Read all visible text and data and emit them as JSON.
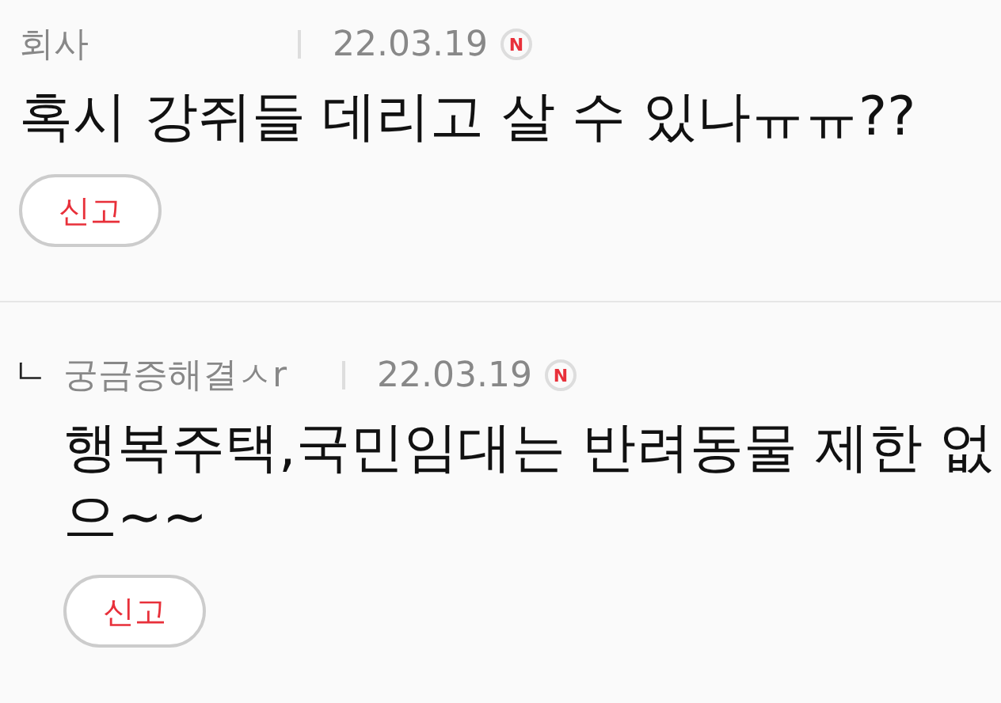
{
  "comments": [
    {
      "author": "회사",
      "date": "22.03.19",
      "badge": "N",
      "text": "혹시 강쥐들 데리고 살 수 있나ㅠㅠ??",
      "report_button": "신고",
      "children": [
        {
          "marker": "ㄴ",
          "author": "궁금증해결ㅅr",
          "date": "22.03.19",
          "badge": "N",
          "text": "행복주택,국민임대는 반려동물 제한 없으~~",
          "report_button": "신고"
        }
      ]
    }
  ]
}
